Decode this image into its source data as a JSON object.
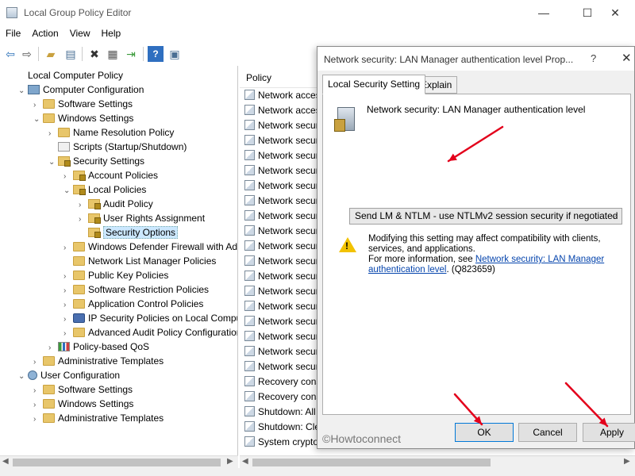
{
  "window": {
    "title": "Local Group Policy Editor",
    "minimize": "—",
    "maximize": "☐",
    "close": "✕"
  },
  "menu": [
    "File",
    "Action",
    "View",
    "Help"
  ],
  "toolbar_icons": [
    "back-icon",
    "forward-icon",
    "up-folder-icon",
    "show-hide-tree-icon",
    "delete-icon",
    "properties-icon",
    "export-icon",
    "help-icon",
    "console-icon"
  ],
  "tree": [
    {
      "label": "Local Computer Policy",
      "icon": "policy",
      "indent": 0,
      "chev": ""
    },
    {
      "label": "Computer Configuration",
      "icon": "pc",
      "indent": 1,
      "chev": "v"
    },
    {
      "label": "Software Settings",
      "icon": "folder",
      "indent": 2,
      "chev": ">"
    },
    {
      "label": "Windows Settings",
      "icon": "folder",
      "indent": 2,
      "chev": "v"
    },
    {
      "label": "Name Resolution Policy",
      "icon": "folder",
      "indent": 3,
      "chev": ">"
    },
    {
      "label": "Scripts (Startup/Shutdown)",
      "icon": "script",
      "indent": 3,
      "chev": ""
    },
    {
      "label": "Security Settings",
      "icon": "lock",
      "indent": 3,
      "chev": "v"
    },
    {
      "label": "Account Policies",
      "icon": "lock",
      "indent": 4,
      "chev": ">"
    },
    {
      "label": "Local Policies",
      "icon": "lock",
      "indent": 4,
      "chev": "v"
    },
    {
      "label": "Audit Policy",
      "icon": "lock",
      "indent": 5,
      "chev": ">"
    },
    {
      "label": "User Rights Assignment",
      "icon": "lock",
      "indent": 5,
      "chev": ">"
    },
    {
      "label": "Security Options",
      "icon": "lock",
      "indent": 5,
      "chev": "",
      "selected": true
    },
    {
      "label": "Windows Defender Firewall with Adva",
      "icon": "folder",
      "indent": 4,
      "chev": ">"
    },
    {
      "label": "Network List Manager Policies",
      "icon": "folder",
      "indent": 4,
      "chev": ""
    },
    {
      "label": "Public Key Policies",
      "icon": "folder",
      "indent": 4,
      "chev": ">"
    },
    {
      "label": "Software Restriction Policies",
      "icon": "folder",
      "indent": 4,
      "chev": ">"
    },
    {
      "label": "Application Control Policies",
      "icon": "folder",
      "indent": 4,
      "chev": ">"
    },
    {
      "label": "IP Security Policies on Local Compute",
      "icon": "ipsec",
      "indent": 4,
      "chev": ">"
    },
    {
      "label": "Advanced Audit Policy Configuration",
      "icon": "folder",
      "indent": 4,
      "chev": ">"
    },
    {
      "label": "Policy-based QoS",
      "icon": "qos",
      "indent": 3,
      "chev": ">"
    },
    {
      "label": "Administrative Templates",
      "icon": "folder",
      "indent": 2,
      "chev": ">"
    },
    {
      "label": "User Configuration",
      "icon": "user",
      "indent": 1,
      "chev": "v"
    },
    {
      "label": "Software Settings",
      "icon": "folder",
      "indent": 2,
      "chev": ">"
    },
    {
      "label": "Windows Settings",
      "icon": "folder",
      "indent": 2,
      "chev": ">"
    },
    {
      "label": "Administrative Templates",
      "icon": "folder",
      "indent": 2,
      "chev": ">"
    }
  ],
  "list": {
    "header": "Policy",
    "rows": [
      "Network acces",
      "Network acces",
      "Network secur",
      "Network secur",
      "Network secur",
      "Network secur",
      "Network secur",
      "Network secur",
      "Network secur",
      "Network secur",
      "Network secur",
      "Network secur",
      "Network secur",
      "Network secur",
      "Network secur",
      "Network secur",
      "Network secur",
      "Network secur",
      "Network secur",
      "Recovery cons",
      "Recovery cons",
      "Shutdown: All",
      "Shutdown: Cle",
      "System crypto"
    ],
    "selected_index": 8
  },
  "dialog": {
    "title": "Network security: LAN Manager authentication level Prop...",
    "help": "?",
    "close": "✕",
    "tabs": [
      "Local Security Setting",
      "Explain"
    ],
    "policy_name": "Network security: LAN Manager authentication level",
    "selected_option": "Send LM & NTLM - use NTLMv2 session security if negotiated",
    "warning_line1": "Modifying this setting may affect compatibility with clients, services, and applications.",
    "more_info_prefix": "For more information, see ",
    "more_info_link": "Network security: LAN Manager authentication level",
    "more_info_suffix": ". (Q823659)",
    "buttons": {
      "ok": "OK",
      "cancel": "Cancel",
      "apply": "Apply"
    }
  },
  "watermark": "©Howtoconnect",
  "annotation_color": "#e3001b"
}
